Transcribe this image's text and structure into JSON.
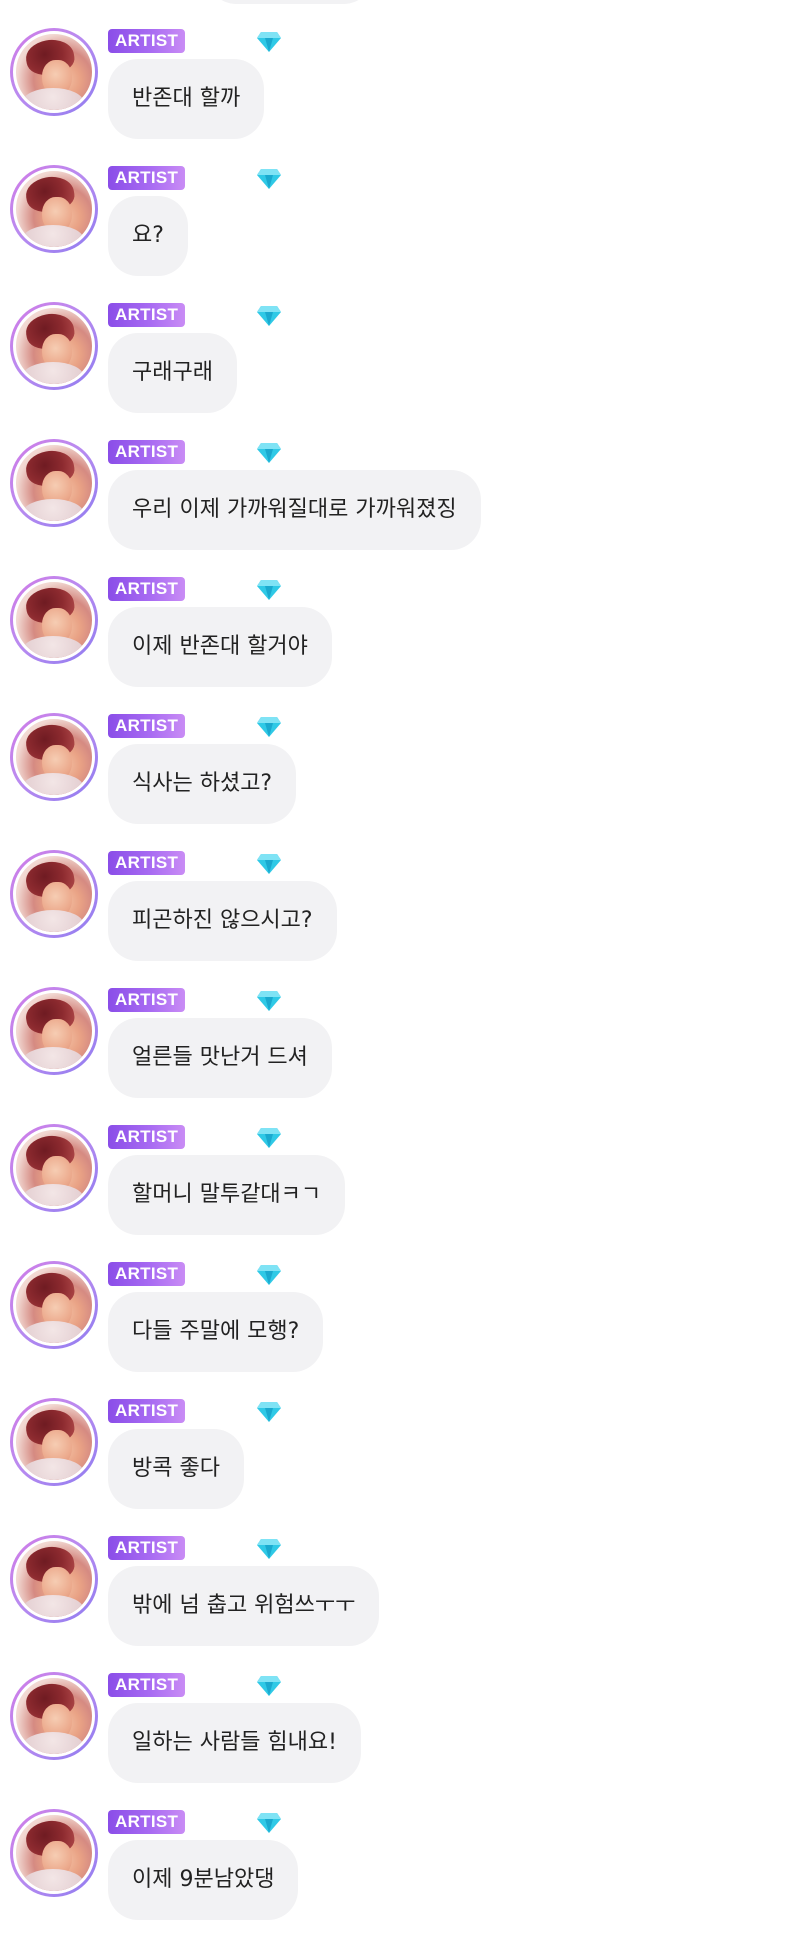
{
  "author_badge": "ARTIST",
  "accent": {
    "badge_gradient": [
      "#8a4de8",
      "#c98cf5"
    ],
    "diamond": "#2fc9e6",
    "bubble_bg": "#f2f2f4"
  },
  "icons": {
    "badge_icon": "diamond-icon"
  },
  "messages": [
    {
      "text": "반존대 할까"
    },
    {
      "text": "요?"
    },
    {
      "text": "구래구래"
    },
    {
      "text": "우리 이제 가까워질대로 가까워졌징"
    },
    {
      "text": "이제 반존대 할거야"
    },
    {
      "text": "식사는 하셨고?"
    },
    {
      "text": "피곤하진 않으시고?"
    },
    {
      "text": "얼른들 맛난거 드셔"
    },
    {
      "text": "할머니 말투같대ㅋㄱ"
    },
    {
      "text": "다들 주말에 모행?"
    },
    {
      "text": "방콕 좋다"
    },
    {
      "text": "밖에 넘 춥고 위험쓰ㅜㅜ"
    },
    {
      "text": "일하는 사람들 힘내요!"
    },
    {
      "text": "이제 9분남았댕"
    }
  ]
}
